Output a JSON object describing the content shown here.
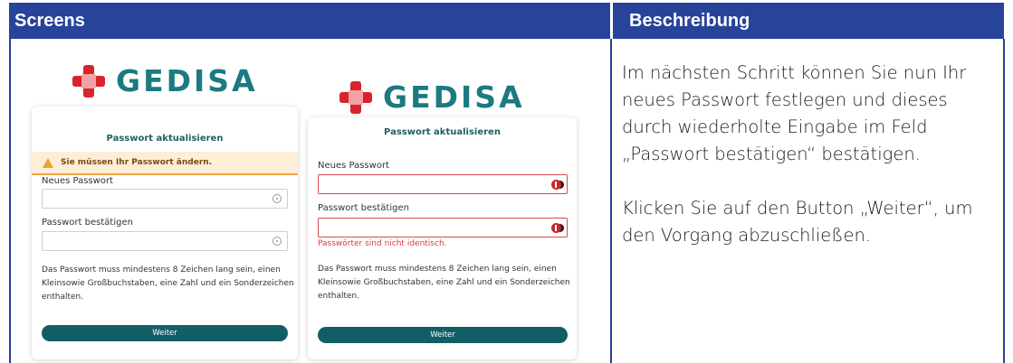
{
  "table": {
    "col_screens": "Screens",
    "col_description": "Beschreibung"
  },
  "description": {
    "para1": "Im nächsten Schritt können Sie nun Ihr neues Passwort festlegen und die­ses durch wiederholte Eingabe im Feld „Passwort bestätigen“ bestäti­gen.",
    "para2": "Klicken Sie auf den Button „Weiter“, um den Vorgang abzuschließen."
  },
  "logo_text": "GEDISA",
  "screen1": {
    "title": "Passwort aktualisieren",
    "warning": "Sie müssen Ihr Passwort ändern.",
    "new_pw_label": "Neues Passwort",
    "confirm_pw_label": "Passwort bestätigen",
    "hint": "Das Passwort muss mindestens 8 Zeichen lang sein, einen Klein­sowie Großbuchstaben, eine Zahl und ein Sonderzeichen enthalten.",
    "button": "Weiter"
  },
  "screen2": {
    "title": "Passwort aktualisieren",
    "new_pw_label": "Neues Passwort",
    "confirm_pw_label": "Passwort bestätigen",
    "error": "Passwörter sind nicht identisch.",
    "hint": "Das Passwort muss mindestens 8 Zeichen lang sein, einen Klein­sowie Großbuchstaben, eine Zahl und ein Sonderzeichen enthalten.",
    "button": "Weiter"
  },
  "colors": {
    "header_blue": "#27449a",
    "teal": "#1c7a80",
    "button_teal": "#125e66",
    "logo_red": "#d8242d",
    "error_red": "#d93a3a",
    "warning_bg": "#fdeed8"
  }
}
